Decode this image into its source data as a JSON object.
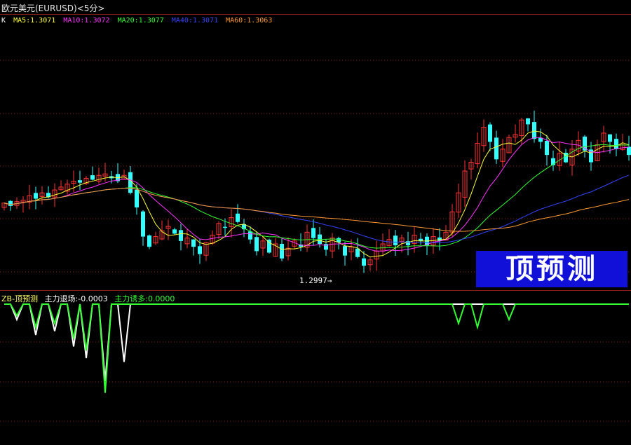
{
  "title": "欧元美元(EURUSD)<5分>",
  "ma_bar": [
    {
      "label": "K",
      "color": "#ffffff"
    },
    {
      "label": "MA5:1.3071",
      "color": "#ffff33"
    },
    {
      "label": "MA10:1.3072",
      "color": "#ff33ff"
    },
    {
      "label": "MA20:1.3077",
      "color": "#33ff33"
    },
    {
      "label": "MA40:1.3071",
      "color": "#3344ff"
    },
    {
      "label": "MA60:1.3063",
      "color": "#ff9933"
    }
  ],
  "indicator_bar": [
    {
      "label": "ZB-顶预测",
      "color": "#ffff66"
    },
    {
      "label": "主力退场:-0.0003",
      "color": "#ffffff"
    },
    {
      "label": "主力诱多:0.0000",
      "color": "#33ff33"
    }
  ],
  "badge_text": "顶预测",
  "low_label": "1.2997→",
  "colors": {
    "up": "#ff3333",
    "down": "#33ffff",
    "grid": "#8a1e1e"
  },
  "chart_data": [
    {
      "type": "candlestick",
      "title": "欧元美元(EURUSD)<5分>",
      "price_close": [
        1.3038,
        1.3036,
        1.3039,
        1.304,
        1.3043,
        1.3041,
        1.3045,
        1.3042,
        1.3047,
        1.3049,
        1.3051,
        1.3053,
        1.3052,
        1.3055,
        1.3054,
        1.3057,
        1.3058,
        1.3055,
        1.3053,
        1.3057,
        1.3045,
        1.3035,
        1.3015,
        1.3008,
        1.3015,
        1.3019,
        1.3022,
        1.3017,
        1.3012,
        1.3014,
        1.3008,
        1.3003,
        1.3011,
        1.3016,
        1.3024,
        1.3021,
        1.3028,
        1.3025,
        1.302,
        1.3013,
        1.3005,
        1.3012,
        1.3004,
        1.301,
        1.3,
        1.3007,
        1.3012,
        1.3008,
        1.3018,
        1.3014,
        1.301,
        1.3006,
        1.3014,
        1.3011,
        1.3002,
        1.3008,
        1.3001,
        1.2995,
        1.2999,
        1.3005,
        1.301,
        1.3013,
        1.3009,
        1.3014,
        1.3009,
        1.3016,
        1.3012,
        1.3009,
        1.3015,
        1.3012,
        1.3018,
        1.3032,
        1.3045,
        1.306,
        1.3066,
        1.3079,
        1.309,
        1.308,
        1.3068,
        1.3075,
        1.3083,
        1.3085,
        1.3095,
        1.3092,
        1.3082,
        1.308,
        1.3071,
        1.3064,
        1.3072,
        1.3066,
        1.3075,
        1.3081,
        1.3074,
        1.3066,
        1.3078,
        1.3086,
        1.308,
        1.3075,
        1.3078,
        1.3071
      ],
      "ma5_last": 1.3071,
      "ma10_last": 1.3072,
      "ma20_last": 1.3077,
      "ma40_last": 1.3071,
      "ma60_last": 1.3063,
      "annotation_low": 1.2997
    },
    {
      "type": "line",
      "title": "ZB-顶预测",
      "series": [
        {
          "name": "主力退场",
          "spikes": [
            [
              2,
              4
            ],
            [
              5,
              8
            ],
            [
              8,
              7
            ],
            [
              11,
              11
            ],
            [
              13,
              14
            ],
            [
              16,
              20
            ],
            [
              19,
              15
            ]
          ]
        },
        {
          "name": "主力诱多",
          "spikes": [
            [
              2,
              3
            ],
            [
              5,
              6
            ],
            [
              8,
              5
            ],
            [
              11,
              9
            ],
            [
              13,
              12
            ],
            [
              16,
              23
            ],
            [
              72,
              5
            ],
            [
              75,
              6
            ],
            [
              80,
              4
            ]
          ]
        }
      ]
    }
  ]
}
